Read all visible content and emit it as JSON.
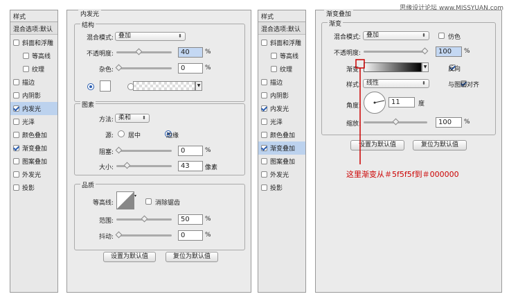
{
  "watermark": "思缘设计论坛 www.MISSYUAN.com",
  "left_styles": {
    "title": "样式",
    "blend": "混合选项:默认",
    "items": [
      {
        "label": "斜面和浮雕",
        "checked": false,
        "indent": false,
        "selected": false
      },
      {
        "label": "等高线",
        "checked": false,
        "indent": true,
        "selected": false
      },
      {
        "label": "纹理",
        "checked": false,
        "indent": true,
        "selected": false
      },
      {
        "label": "描边",
        "checked": false,
        "indent": false,
        "selected": false
      },
      {
        "label": "内阴影",
        "checked": false,
        "indent": false,
        "selected": false
      },
      {
        "label": "内发光",
        "checked": true,
        "indent": false,
        "selected": true
      },
      {
        "label": "光泽",
        "checked": false,
        "indent": false,
        "selected": false
      },
      {
        "label": "颜色叠加",
        "checked": false,
        "indent": false,
        "selected": false
      },
      {
        "label": "渐变叠加",
        "checked": true,
        "indent": false,
        "selected": false
      },
      {
        "label": "图案叠加",
        "checked": false,
        "indent": false,
        "selected": false
      },
      {
        "label": "外发光",
        "checked": false,
        "indent": false,
        "selected": false
      },
      {
        "label": "投影",
        "checked": false,
        "indent": false,
        "selected": false
      }
    ]
  },
  "inner_glow": {
    "title": "内发光",
    "structure": {
      "title": "结构",
      "blend_label": "混合模式:",
      "blend_value": "叠加",
      "opacity_label": "不透明度:",
      "opacity_value": "40",
      "opacity_pct": 40,
      "noise_label": "杂色:",
      "noise_value": "0",
      "noise_pct": 0,
      "unit": "%"
    },
    "elements": {
      "title": "图素",
      "method_label": "方法:",
      "method_value": "柔和",
      "source_label": "源:",
      "source_center": "居中",
      "source_edge": "边缘",
      "choke_label": "阻塞:",
      "choke_value": "0",
      "choke_pct": 0,
      "size_label": "大小:",
      "size_value": "43",
      "size_level": 0.17,
      "unit_pct": "%",
      "unit_px": "像素"
    },
    "quality": {
      "title": "品质",
      "contour_label": "等高线:",
      "antialias_label": "消除锯齿",
      "range_label": "范围:",
      "range_value": "50",
      "range_pct": 50,
      "jitter_label": "抖动:",
      "jitter_value": "0",
      "jitter_pct": 0,
      "unit": "%"
    },
    "btn_default": "设置为默认值",
    "btn_reset": "复位为默认值"
  },
  "right_styles": {
    "title": "样式",
    "blend": "混合选项:默认",
    "items": [
      {
        "label": "斜面和浮雕",
        "checked": false,
        "indent": false,
        "selected": false
      },
      {
        "label": "等高线",
        "checked": false,
        "indent": true,
        "selected": false
      },
      {
        "label": "纹理",
        "checked": false,
        "indent": true,
        "selected": false
      },
      {
        "label": "描边",
        "checked": false,
        "indent": false,
        "selected": false
      },
      {
        "label": "内阴影",
        "checked": false,
        "indent": false,
        "selected": false
      },
      {
        "label": "内发光",
        "checked": true,
        "indent": false,
        "selected": false
      },
      {
        "label": "光泽",
        "checked": false,
        "indent": false,
        "selected": false
      },
      {
        "label": "颜色叠加",
        "checked": false,
        "indent": false,
        "selected": false
      },
      {
        "label": "渐变叠加",
        "checked": true,
        "indent": false,
        "selected": true
      },
      {
        "label": "图案叠加",
        "checked": false,
        "indent": false,
        "selected": false
      },
      {
        "label": "外发光",
        "checked": false,
        "indent": false,
        "selected": false
      },
      {
        "label": "投影",
        "checked": false,
        "indent": false,
        "selected": false
      }
    ]
  },
  "gradient_overlay": {
    "title": "渐变叠加",
    "section": "渐变",
    "blend_label": "混合模式:",
    "blend_value": "叠加",
    "dither_label": "仿色",
    "opacity_label": "不透明度:",
    "opacity_value": "100",
    "opacity_pct": 100,
    "gradient_label": "渐变:",
    "reverse_label": "反向",
    "style_label": "样式:",
    "style_value": "线性",
    "align_label": "与图层对齐",
    "angle_label": "角度:",
    "angle_value": "11",
    "angle_unit": "度",
    "scale_label": "缩放:",
    "scale_value": "100",
    "scale_pct": 100,
    "unit": "%",
    "gradient_from": "#f5f5f5",
    "gradient_to": "#000000",
    "btn_default": "设置为默认值",
    "btn_reset": "复位为默认值"
  },
  "callout": "这里渐变从＃5f5f5f到＃000000",
  "accent_red": "#cc0000"
}
